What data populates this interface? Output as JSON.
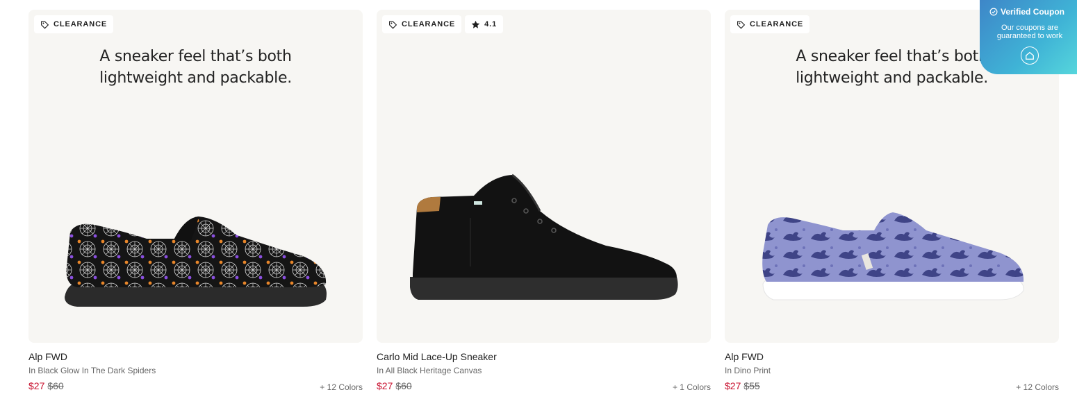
{
  "products": [
    {
      "badges": {
        "clearance": "CLEARANCE"
      },
      "headline_line1": "A sneaker feel that’s both",
      "headline_line2": "lightweight and packable.",
      "name": "Alp FWD",
      "variant": "In Black Glow In The Dark Spiders",
      "price": "$27",
      "was_price": "$60",
      "colors": "+ 12 Colors"
    },
    {
      "badges": {
        "clearance": "CLEARANCE",
        "rating": "4.1"
      },
      "name": "Carlo Mid Lace-Up Sneaker",
      "variant": "In All Black Heritage Canvas",
      "price": "$27",
      "was_price": "$60",
      "colors": "+ 1 Colors"
    },
    {
      "badges": {
        "clearance": "CLEARANCE"
      },
      "headline_line1": "A sneaker feel that’s both",
      "headline_line2": "lightweight and packable.",
      "name": "Alp FWD",
      "variant": "In Dino Print",
      "price": "$27",
      "was_price": "$55",
      "colors": "+ 12 Colors"
    }
  ],
  "coupon": {
    "title": "Verified Coupon",
    "subtitle": "Our coupons are guaranteed to work"
  },
  "icons": [
    "tag-icon",
    "star-icon",
    "check-circle-icon",
    "home-icon"
  ],
  "colors": {
    "sale_price": "#c8102e",
    "tile_bg": "#f7f6f3"
  }
}
